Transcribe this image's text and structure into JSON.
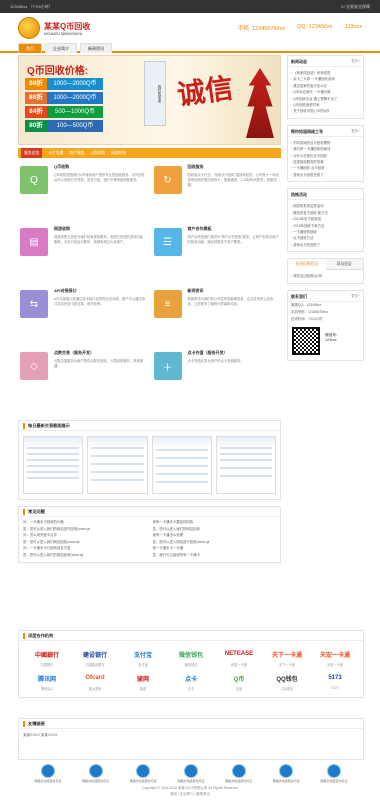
{
  "topbar": {
    "phone": "123456xx （7*24小时）",
    "right": "☑ 交易安全保障"
  },
  "header": {
    "logo_title": "某某Q币回收",
    "logo_sub": "MOUMOU QBIHUISHOU",
    "phone_label": "手机: 123456789xx",
    "qq_label": "QQ: 123456xx",
    "site": "123xxx"
  },
  "nav": {
    "items": [
      "首页",
      "企业简介",
      "新闻资讯"
    ]
  },
  "banner": {
    "headline": "Q币回收价格:",
    "seal": "我们的承诺",
    "calligraphy": "诚信",
    "rates": [
      {
        "k": "89折",
        "v": "1000—2000Q币"
      },
      {
        "k": "86折",
        "v": "1000—2000Q币"
      },
      {
        "k": "84折",
        "v": "500—1000Q币"
      },
      {
        "k": "80折",
        "v": "100—500Q币"
      }
    ]
  },
  "tabs": [
    "服务总览",
    "卡片兑换",
    "商户服务",
    "Q币收购",
    "网游收购"
  ],
  "services": [
    {
      "title": "Q币收购",
      "desc": "Q币收购是指我们Q币使用商户提供专业的回收服务。Q币回收后可以多种方式提现，如支付宝、银行卡等快速到账服务。",
      "color": "#7dc36b",
      "icon": "Q"
    },
    {
      "title": "回收服务",
      "desc": "回收各点卡行业、“回收点卡回收”直接帮回收，公司有十一年经营等全面完整的游戏卡，快速通道。1-10秒时间完成，到账快捷。",
      "color": "#f0a03c",
      "icon": "↻"
    },
    {
      "title": "网游收购",
      "desc": "网游收购业务是为我们玩家提供服务。收购已完成的游戏内装备等，业务已经运行数年，现拥有超过大量用户。",
      "color": "#d97bc4",
      "icon": "▤"
    },
    {
      "title": "商户合作模板",
      "desc": "商户合作是我们提供为“商户合作回收”服务，让商户实现对用户的回收功能，满足其服务于商户需求。",
      "color": "#56b6e8",
      "icon": "☰"
    },
    {
      "title": "API对接接口",
      "desc": "API对接接口是通过技术接口实现的业务对接，客户可以通过接口自动完成卡密交易，提升效率。",
      "color": "#9a8ed6",
      "icon": "⇆"
    },
    {
      "title": "新闻资讯",
      "desc": "新闻资讯为我们的公司发布的新闻信息，企业发布的公告信息，让您更多了解我们的最新动态。",
      "color": "#e8a33c",
      "icon": "≡"
    },
    {
      "title": "点数交易（服务开发）",
      "desc": "点数交易服务为客户提供点数的回收，卡类回收服务，快速便捷。",
      "color": "#e6a0b5",
      "icon": "◇"
    },
    {
      "title": "点卡充值（服务开发）",
      "desc": "点卡充值业务为用户的点卡充值服务。",
      "color": "#5fb8d0",
      "icon": "＋"
    }
  ],
  "screens": {
    "title": "每日最新交易截图展示"
  },
  "qa": {
    "title": "常见问题",
    "items": [
      {
        "q": "问：一卡通手卡回收的价格",
        "a": "我有一卡通手卡要如何回收"
      },
      {
        "q": "答：您可以进入我们的网站进行回收(www.qk",
        "a": "答：您可以进入我们的网站回收"
      },
      {
        "q": "问：怎么用充值卡点评",
        "a": "我有一卡通怎么处理"
      },
      {
        "q": "答：您可以进入我们网站回收(www.qk",
        "a": "答：您可以进入网站进行回收(www.qk"
      },
      {
        "q": "问：一卡通手卡已经转到支付宝",
        "a": "卖一卡通手卡一卡通"
      },
      {
        "q": "答：您可以进入我们的网站回收(www.qk",
        "a": "答：我们可以回收所有一卡通卡"
      }
    ]
  },
  "side": {
    "news": {
      "title": "新闻动态",
      "more": "更多+",
      "items": [
        "《商家成品站》贵请说是",
        "买卡二卡券 一卡通回收游戏",
        "遇见回家的宝贝怎么办",
        "Q币对应地代 一卡通价格",
        "Q币回收平台 遇上冒牌平台了",
        "Q币回收回收时间",
        "关于回收中的心中的Q币"
      ]
    },
    "industry": {
      "title": "帮你知道网络工号",
      "more": "更多+",
      "items": [
        "不同游戏的点卡回收需知",
        "我们有一卡通回收的秘诀",
        "为什么在我们点卡回收",
        "这类回收服务的流程",
        "一卡通回收 点卡回收",
        "游戏点卡回收完成了"
      ]
    },
    "hot": {
      "title": "热推活动",
      "items": [
        "网游的发现这类活动",
        "微信的发卡回收 新方法",
        "2015年发卡回收啦",
        "2015年回收卡有方法",
        "一卡通收购回收",
        "点卡回收方法",
        "游戏点卡的回收了"
      ]
    },
    "tabs": [
      "在线回收验证",
      "网址验证"
    ],
    "verify": "请在这边回收QQ号",
    "contact": {
      "title": "联系我们",
      "more": "更多+",
      "lines": [
        "客服QQ：123456xx",
        "手机号码：123456789xx",
        "在线时间：7X24小时"
      ],
      "wechat": "微信号：",
      "wechat_val": "123xxx"
    }
  },
  "partners": {
    "title": "深度合作机构",
    "items": [
      {
        "name": "中国银行",
        "logo": "中國銀行",
        "color": "#c8201b"
      },
      {
        "name": "中国建设银行",
        "logo": "建设银行",
        "color": "#1b4a9c"
      },
      {
        "name": "支付宝",
        "logo": "支付宝",
        "color": "#1b7be0"
      },
      {
        "name": "微信钱包",
        "logo": "微信钱包",
        "color": "#34a853"
      },
      {
        "name": "网易一卡通",
        "logo": "NETEASE",
        "color": "#c8201b"
      },
      {
        "name": "天下一卡通",
        "logo": "天下一卡通",
        "color": "#e8501b"
      },
      {
        "name": "天宏一卡通",
        "logo": "天宏一卡通",
        "color": "#e8501b"
      },
      {
        "name": "腾讯QQ",
        "logo": "腾讯网",
        "color": "#1b7be0"
      },
      {
        "name": "盛大游戏",
        "logo": "Ofcard",
        "color": "#e8501b"
      },
      {
        "name": "骏网",
        "logo": "骏网",
        "color": "#c8201b"
      },
      {
        "name": "点卡",
        "logo": "点卡",
        "color": "#1b7be0"
      },
      {
        "name": "征途",
        "logo": "Q币",
        "color": "#3caa3c"
      },
      {
        "name": "QQ钱包",
        "logo": "QQ钱包",
        "color": "#333"
      },
      {
        "name": "5173",
        "logo": "5173",
        "color": "#1b4a9c"
      }
    ]
  },
  "links": {
    "title": "友情链接",
    "items": "某某XXXX  某某XXXX"
  },
  "badges": [
    "网络文化经营许可证",
    "网络文化经营许可证",
    "网络文化经营许可证",
    "网络文化经营许可证",
    "网络文化经营许可证",
    "网络文化经营许可证",
    "网络文化经营许可证"
  ],
  "footer": {
    "line1": "Copyright © 2016-2018 某某XXXX有限公司 All Rights Reserved",
    "line2": "首页 | 企业简介 | 新闻资讯"
  }
}
